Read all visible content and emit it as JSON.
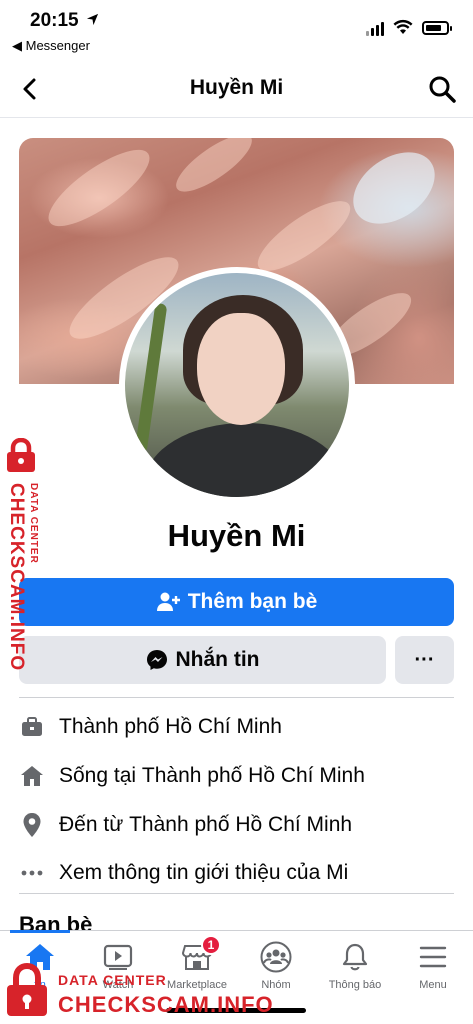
{
  "status_bar": {
    "time": "20:15",
    "back_app": "◀ Messenger"
  },
  "header": {
    "title": "Huyền Mi"
  },
  "profile": {
    "name": "Huyền Mi"
  },
  "actions": {
    "add_friend": "Thêm bạn bè",
    "message": "Nhắn tin",
    "more": "···"
  },
  "info": [
    {
      "icon": "briefcase-icon",
      "prefix": "Thành phố Hồ Chí Minh",
      "value": ""
    },
    {
      "icon": "home-icon",
      "prefix": "Sống tại ",
      "value": "Thành phố Hồ Chí Minh"
    },
    {
      "icon": "location-pin-icon",
      "prefix": "Đến từ ",
      "value": "Thành phố Hồ Chí Minh"
    },
    {
      "icon": "more-dots-icon",
      "prefix": "Xem thông tin giới thiệu của Mi",
      "value": ""
    }
  ],
  "friends_heading": "Bạn bè",
  "tabs": [
    {
      "icon": "home-icon",
      "label": "tin",
      "active": true
    },
    {
      "icon": "watch-icon",
      "label": "Watch"
    },
    {
      "icon": "marketplace-icon",
      "label": "Marketplace",
      "badge": "1"
    },
    {
      "icon": "groups-icon",
      "label": "Nhóm"
    },
    {
      "icon": "bell-icon",
      "label": "Thông báo"
    },
    {
      "icon": "menu-icon",
      "label": "Menu"
    }
  ],
  "watermark": {
    "small": "DATA CENTER",
    "large": "CHECKSCAM.INFO"
  },
  "colors": {
    "accent": "#1877f2",
    "button_gray": "#e4e6eb",
    "watermark": "#d7232a",
    "badge": "#e41e3f"
  }
}
